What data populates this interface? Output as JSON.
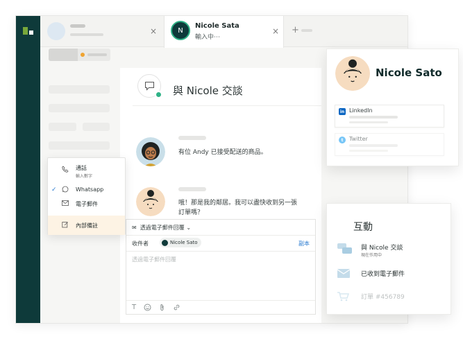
{
  "tabs": {
    "close_glyph": "×",
    "active": {
      "avatar_initial": "N",
      "name": "Nicole Sata",
      "status": "輸入中⋯"
    },
    "add_glyph": "+"
  },
  "panel": {
    "title": "與 Nicole 交談",
    "messages": [
      {
        "text": "有位 Andy 已接受配送的商品。"
      },
      {
        "text_line1": "哦！那是我的鄰居。我可以盡快收到另一張",
        "text_line2": "訂單嗎？"
      }
    ]
  },
  "menu": {
    "items": [
      {
        "icon": "phone-icon",
        "label": "通話",
        "sublabel": "輸入數字"
      },
      {
        "icon": "whatsapp-icon",
        "label": "Whatsapp",
        "selected": true
      },
      {
        "icon": "email-icon",
        "label": "電子郵件"
      },
      {
        "icon": "note-icon",
        "label": "內部備註"
      }
    ]
  },
  "composer": {
    "channel_label": "透過電子郵件回覆",
    "recipient_label": "收件者",
    "recipient_name": "Nicole Sato",
    "copy_label": "副本",
    "placeholder": "透過電子郵件回覆",
    "tools": [
      "T"
    ]
  },
  "profile": {
    "name": "Nicole Sato",
    "socials": [
      {
        "badge": "in",
        "label": "LinkedIn",
        "color": "#0a66c2"
      },
      {
        "badge": "t",
        "label": "Twitter",
        "color": "#1da1f2"
      }
    ]
  },
  "interactions": {
    "title": "互動",
    "items": [
      {
        "icon": "chat-icon",
        "title": "與 Nicole 交談",
        "subtitle": "現在作用中"
      },
      {
        "icon": "mail-icon",
        "title": "已收到電子郵件"
      },
      {
        "icon": "cart-icon",
        "title": "訂單 #456789"
      }
    ]
  },
  "colors": {
    "rail": "#0e3a3a",
    "accent_green": "#2fb287",
    "status_orange": "#f0a431",
    "link_blue": "#2a7bd0"
  }
}
